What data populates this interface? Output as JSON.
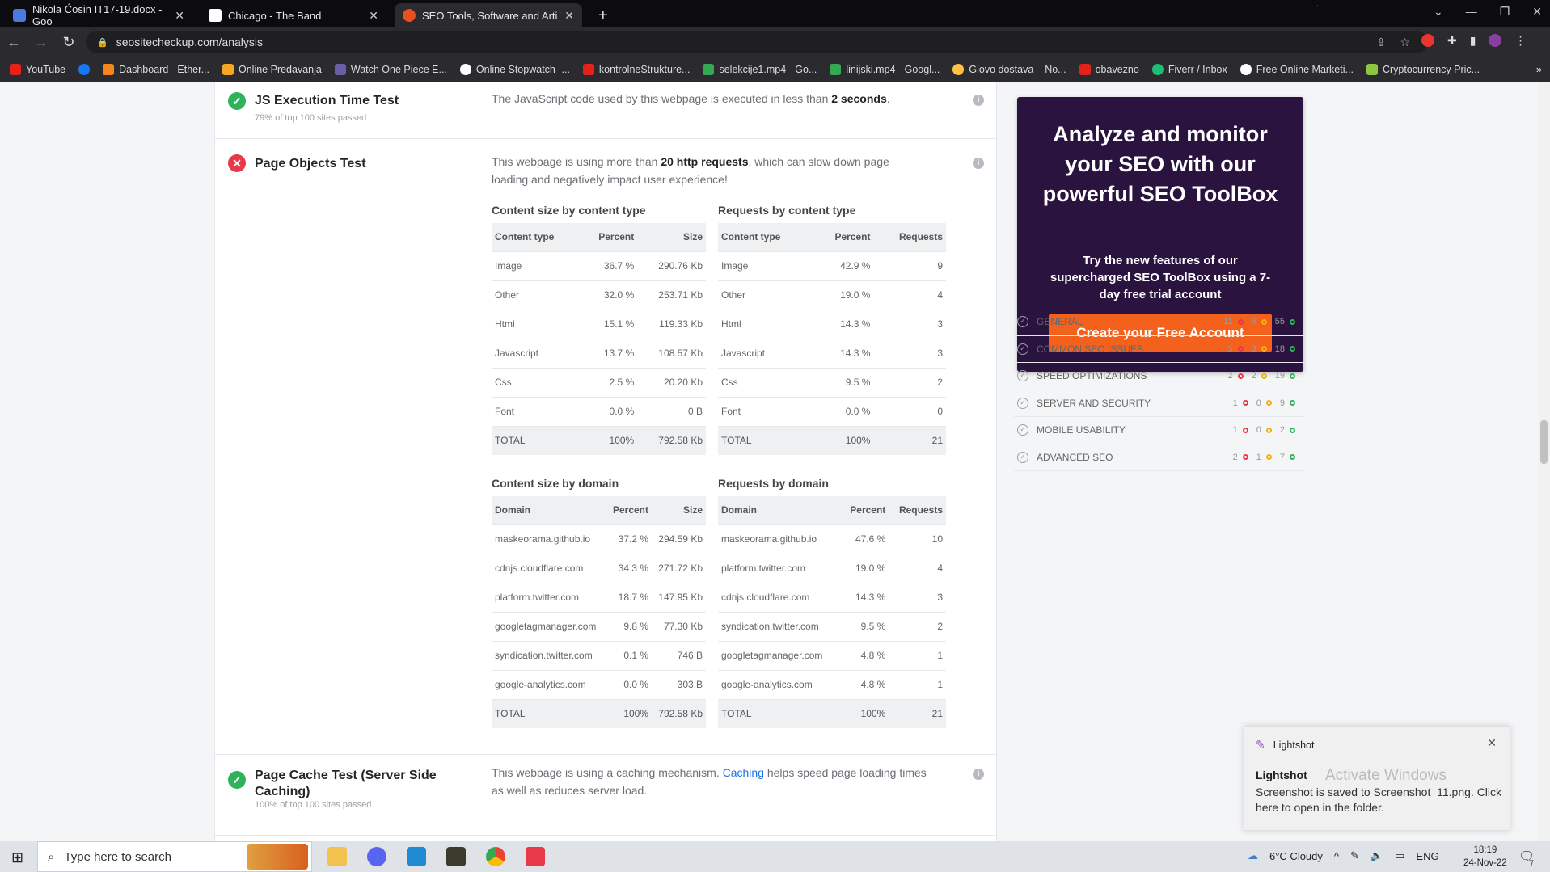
{
  "browser": {
    "tabs": [
      {
        "title": "Nikola Ćosin IT17-19.docx - Goo",
        "favicon_color": "#4a7bd8"
      },
      {
        "title": "Chicago - The Band",
        "favicon_color": "#ffffff"
      },
      {
        "title": "SEO Tools, Software and Articles",
        "favicon_color": "#e8501d",
        "active": true
      }
    ],
    "new_tab": "+",
    "url": "seositecheckup.com/analysis",
    "bookmarks": [
      {
        "label": "YouTube",
        "color": "#e62117"
      },
      {
        "label": "",
        "color": "#1877f2"
      },
      {
        "label": "Dashboard - Ether...",
        "color": "#f6851b"
      },
      {
        "label": "Online Predavanja",
        "color": "#f5a623"
      },
      {
        "label": "Watch One Piece E...",
        "color": "#6b5ea8"
      },
      {
        "label": "Online Stopwatch -...",
        "color": "#ffffff"
      },
      {
        "label": "kontrolneStrukture...",
        "color": "#e62117"
      },
      {
        "label": "selekcije1.mp4 - Go...",
        "color": "#34a853"
      },
      {
        "label": "linijski.mp4 - Googl...",
        "color": "#34a853"
      },
      {
        "label": "Glovo dostava – No...",
        "color": "#ffc244"
      },
      {
        "label": "obavezno",
        "color": "#e62117"
      },
      {
        "label": "Fiverr / Inbox",
        "color": "#1dbf73"
      },
      {
        "label": "Free Online Marketi...",
        "color": "#ffffff"
      },
      {
        "label": "Cryptocurrency Pric...",
        "color": "#8dc63f"
      }
    ]
  },
  "tests": {
    "js": {
      "title": "JS Execution Time Test",
      "sub": "79% of top 100 sites passed",
      "desc_pre": "The JavaScript code used by this webpage is executed in less than ",
      "desc_bold": "2 seconds",
      "desc_post": "."
    },
    "objects": {
      "title": "Page Objects Test",
      "desc_pre": "This webpage is using more than ",
      "desc_bold": "20 http requests",
      "desc_post": ", which can slow down page loading and negatively impact user experience!"
    },
    "cache": {
      "title": "Page Cache Test (Server Side Caching)",
      "sub": "100% of top 100 sites passed",
      "desc_pre": "This webpage is using a caching mechanism. ",
      "desc_link": "Caching",
      "desc_post": " helps speed page loading times as well as reduces server load."
    }
  },
  "tables": {
    "size_type": {
      "title": "Content size by content type",
      "headers": [
        "Content type",
        "Percent",
        "Size"
      ],
      "rows": [
        [
          "Image",
          "36.7 %",
          "290.76 Kb"
        ],
        [
          "Other",
          "32.0 %",
          "253.71 Kb"
        ],
        [
          "Html",
          "15.1 %",
          "119.33 Kb"
        ],
        [
          "Javascript",
          "13.7 %",
          "108.57 Kb"
        ],
        [
          "Css",
          "2.5 %",
          "20.20 Kb"
        ],
        [
          "Font",
          "0.0 %",
          "0 B"
        ]
      ],
      "total": [
        "TOTAL",
        "100%",
        "792.58 Kb"
      ]
    },
    "req_type": {
      "title": "Requests by content type",
      "headers": [
        "Content type",
        "Percent",
        "Requests"
      ],
      "rows": [
        [
          "Image",
          "42.9 %",
          "9"
        ],
        [
          "Other",
          "19.0 %",
          "4"
        ],
        [
          "Html",
          "14.3 %",
          "3"
        ],
        [
          "Javascript",
          "14.3 %",
          "3"
        ],
        [
          "Css",
          "9.5 %",
          "2"
        ],
        [
          "Font",
          "0.0 %",
          "0"
        ]
      ],
      "total": [
        "TOTAL",
        "100%",
        "21"
      ]
    },
    "size_domain": {
      "title": "Content size by domain",
      "headers": [
        "Domain",
        "Percent",
        "Size"
      ],
      "rows": [
        [
          "maskeorama.github.io",
          "37.2 %",
          "294.59 Kb"
        ],
        [
          "cdnjs.cloudflare.com",
          "34.3 %",
          "271.72 Kb"
        ],
        [
          "platform.twitter.com",
          "18.7 %",
          "147.95 Kb"
        ],
        [
          "googletagmanager.com",
          "9.8 %",
          "77.30 Kb"
        ],
        [
          "syndication.twitter.com",
          "0.1 %",
          "746 B"
        ],
        [
          "google-analytics.com",
          "0.0 %",
          "303 B"
        ]
      ],
      "total": [
        "TOTAL",
        "100%",
        "792.58 Kb"
      ]
    },
    "req_domain": {
      "title": "Requests by domain",
      "headers": [
        "Domain",
        "Percent",
        "Requests"
      ],
      "rows": [
        [
          "maskeorama.github.io",
          "47.6 %",
          "10"
        ],
        [
          "platform.twitter.com",
          "19.0 %",
          "4"
        ],
        [
          "cdnjs.cloudflare.com",
          "14.3 %",
          "3"
        ],
        [
          "syndication.twitter.com",
          "9.5 %",
          "2"
        ],
        [
          "googletagmanager.com",
          "4.8 %",
          "1"
        ],
        [
          "google-analytics.com",
          "4.8 %",
          "1"
        ]
      ],
      "total": [
        "TOTAL",
        "100%",
        "21"
      ]
    }
  },
  "promo": {
    "heading": "Analyze and monitor your SEO with our powerful SEO ToolBox",
    "text": "Try the new features of our supercharged SEO ToolBox using a 7-day free trial account",
    "cta": "Create your Free Account"
  },
  "categories": [
    {
      "label": "GENERAL",
      "red": "11",
      "yellow": "6",
      "green": "55"
    },
    {
      "label": "COMMON SEO ISSUES",
      "red": "5",
      "yellow": "3",
      "green": "18"
    },
    {
      "label": "SPEED OPTIMIZATIONS",
      "red": "2",
      "yellow": "2",
      "green": "19"
    },
    {
      "label": "SERVER AND SECURITY",
      "red": "1",
      "yellow": "0",
      "green": "9"
    },
    {
      "label": "MOBILE USABILITY",
      "red": "1",
      "yellow": "0",
      "green": "2"
    },
    {
      "label": "ADVANCED SEO",
      "red": "2",
      "yellow": "1",
      "green": "7"
    }
  ],
  "toast": {
    "app": "Lightshot",
    "title": "Lightshot",
    "message": "Screenshot is saved to Screenshot_11.png. Click here to open in the folder.",
    "watermark": "Activate Windows"
  },
  "taskbar": {
    "search_placeholder": "Type here to search",
    "weather": "6°C  Cloudy",
    "lang": "ENG",
    "time": "18:19",
    "date": "24-Nov-22",
    "notif_count": "7"
  },
  "colors": {
    "pass": "#2fb35a",
    "fail": "#e8394a",
    "warn": "#f2b015",
    "promo_bg": "#2a133f",
    "cta": "#f3611d",
    "link": "#1a73e8"
  }
}
